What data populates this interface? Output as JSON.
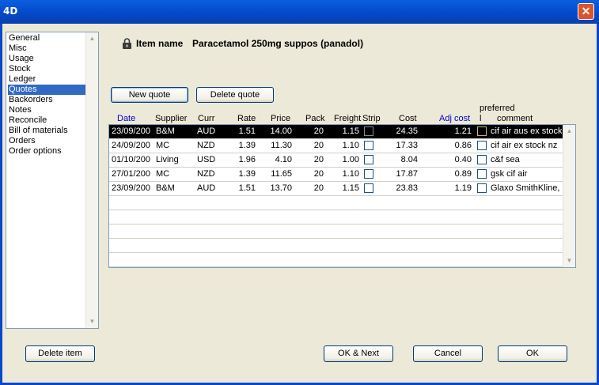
{
  "window": {
    "app_icon_text": "4D",
    "close_glyph": "✕"
  },
  "sidebar": {
    "items": [
      {
        "label": "General",
        "selected": false
      },
      {
        "label": "Misc",
        "selected": false
      },
      {
        "label": "Usage",
        "selected": false
      },
      {
        "label": "Stock",
        "selected": false
      },
      {
        "label": "Ledger",
        "selected": false
      },
      {
        "label": "Quotes",
        "selected": true
      },
      {
        "label": "Backorders",
        "selected": false
      },
      {
        "label": "Notes",
        "selected": false
      },
      {
        "label": "Reconcile",
        "selected": false
      },
      {
        "label": "Bill of materials",
        "selected": false
      },
      {
        "label": "Orders",
        "selected": false
      },
      {
        "label": "Order options",
        "selected": false
      }
    ]
  },
  "item": {
    "label": "Item name",
    "value": "Paracetamol 250mg suppos (panadol)",
    "icon": "lock-icon"
  },
  "buttons": {
    "new_quote": "New quote",
    "delete_quote": "Delete quote",
    "delete_item": "Delete item",
    "ok_next": "OK & Next",
    "cancel": "Cancel",
    "ok": "OK"
  },
  "columns": {
    "date": "Date",
    "supplier": "Supplier",
    "curr": "Curr",
    "rate": "Rate",
    "price": "Price",
    "pack": "Pack",
    "freight": "Freight",
    "strip": "Strip",
    "cost": "Cost",
    "adj_cost": "Adj cost",
    "preferred_line1": "preferred",
    "preferred_line2": "l",
    "comment": "comment"
  },
  "quotes": [
    {
      "date": "23/09/200",
      "supplier": "B&M",
      "curr": "AUD",
      "rate": "1.51",
      "price": "14.00",
      "pack": "20",
      "freight": "1.15",
      "strip": false,
      "cost": "24.35",
      "adj_cost": "1.21",
      "preferred": false,
      "comment": "cif air aus ex stock",
      "selected": true
    },
    {
      "date": "24/09/200",
      "supplier": "MC",
      "curr": "NZD",
      "rate": "1.39",
      "price": "11.30",
      "pack": "20",
      "freight": "1.10",
      "strip": false,
      "cost": "17.33",
      "adj_cost": "0.86",
      "preferred": false,
      "comment": "cif air ex stock nz",
      "selected": false
    },
    {
      "date": "01/10/200",
      "supplier": "Living",
      "curr": "USD",
      "rate": "1.96",
      "price": "4.10",
      "pack": "20",
      "freight": "1.00",
      "strip": false,
      "cost": "8.04",
      "adj_cost": "0.40",
      "preferred": false,
      "comment": "c&f sea",
      "selected": false
    },
    {
      "date": "27/01/200",
      "supplier": "MC",
      "curr": "NZD",
      "rate": "1.39",
      "price": "11.65",
      "pack": "20",
      "freight": "1.10",
      "strip": false,
      "cost": "17.87",
      "adj_cost": "0.89",
      "preferred": false,
      "comment": "gsk cif air",
      "selected": false
    },
    {
      "date": "23/09/200",
      "supplier": "B&M",
      "curr": "AUD",
      "rate": "1.51",
      "price": "13.70",
      "pack": "20",
      "freight": "1.15",
      "strip": false,
      "cost": "23.83",
      "adj_cost": "1.19",
      "preferred": false,
      "comment": "Glaxo SmithKline,",
      "selected": false
    }
  ],
  "colors": {
    "title_bar": "#0349C9",
    "selection": "#316AC5",
    "link_header": "#0000CC",
    "selected_row": "#000000",
    "dialog_bg": "#ECE9D8"
  }
}
